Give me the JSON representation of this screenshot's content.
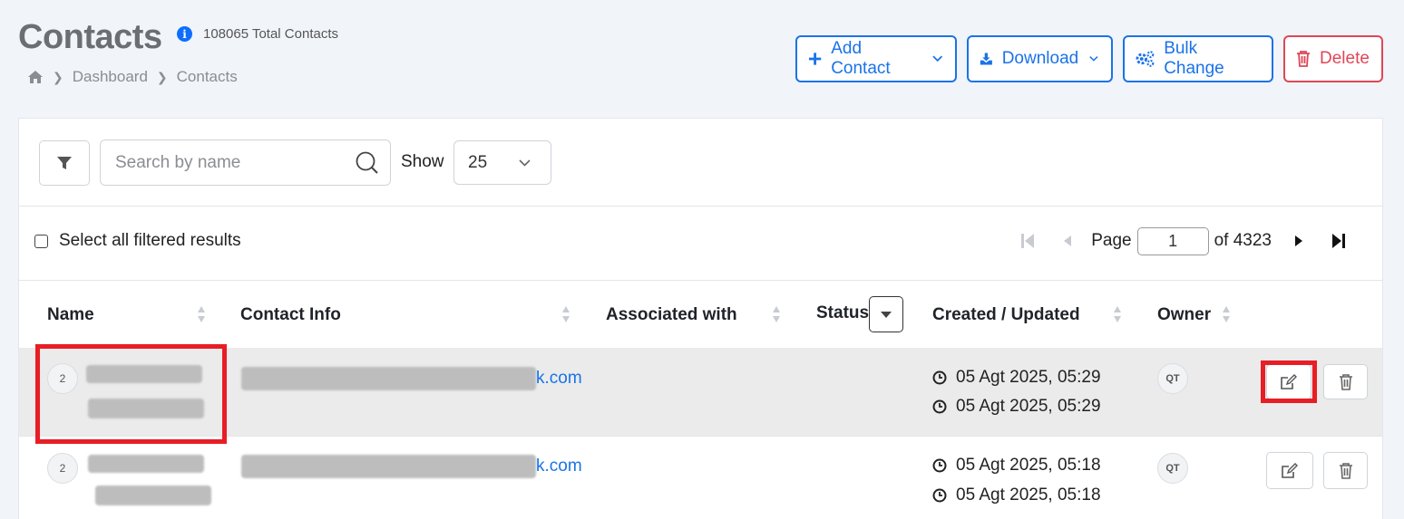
{
  "header": {
    "title": "Contacts",
    "total_text": "108065 Total Contacts",
    "info_icon": "i"
  },
  "breadcrumb": {
    "items": [
      "Dashboard",
      "Contacts"
    ]
  },
  "actions": {
    "add_contact": "Add Contact",
    "download": "Download",
    "bulk_change": "Bulk Change",
    "delete": "Delete"
  },
  "toolbar": {
    "search_placeholder": "Search by name",
    "show_label": "Show",
    "show_value": "25"
  },
  "selection": {
    "select_all_label": "Select all filtered results"
  },
  "pager": {
    "page_label": "Page",
    "current_page": "1",
    "of_label": "of 4323"
  },
  "table": {
    "columns": [
      "Name",
      "Contact Info",
      "Associated with",
      "Status",
      "Created / Updated",
      "Owner"
    ],
    "rows": [
      {
        "avatar": "2",
        "email_tail": "k.com",
        "created": "05 Agt 2025, 05:29",
        "updated": "05 Agt 2025, 05:29",
        "owner": "QT"
      },
      {
        "avatar": "2",
        "email_tail": "k.com",
        "created": "05 Agt 2025, 05:18",
        "updated": "05 Agt 2025, 05:18",
        "owner": "QT"
      }
    ]
  },
  "colors": {
    "primary": "#1a73e8",
    "danger": "#e04656",
    "highlight": "#e81d25"
  }
}
